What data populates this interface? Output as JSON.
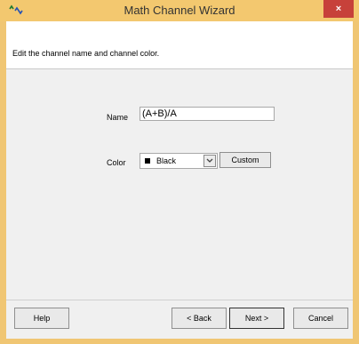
{
  "window": {
    "title": "Math Channel Wizard",
    "close_label": "×"
  },
  "header": {
    "instruction": "Edit the channel name and channel color."
  },
  "form": {
    "name_label": "Name",
    "name_value": "(A+B)/A",
    "color_label": "Color",
    "color_selected": "Black",
    "color_swatch_hex": "#000000",
    "custom_button": "Custom"
  },
  "footer": {
    "help": "Help",
    "back": "< Back",
    "next": "Next >",
    "cancel": "Cancel"
  },
  "colors": {
    "titlebar": "#f3c86f",
    "close": "#c7413a",
    "client": "#f0f0f0"
  }
}
